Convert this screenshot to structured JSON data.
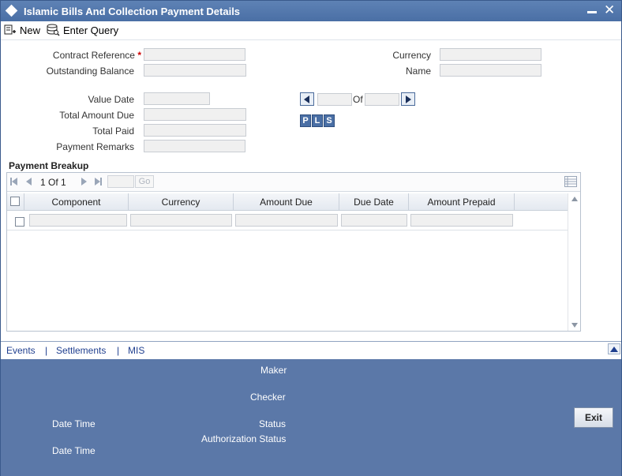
{
  "window": {
    "title": "Islamic Bills And Collection Payment Details",
    "close_glyph": "✕"
  },
  "toolbar": {
    "new_label": "New",
    "enter_query_label": "Enter Query"
  },
  "form": {
    "contract_reference_label": "Contract Reference",
    "required_mark": "*",
    "outstanding_balance_label": "Outstanding Balance",
    "currency_label": "Currency",
    "name_label": "Name",
    "value_date_label": "Value Date",
    "total_amount_due_label": "Total Amount Due",
    "total_paid_label": "Total Paid",
    "payment_remarks_label": "Payment Remarks",
    "of_label": "Of",
    "pls_buttons": [
      "P",
      "L",
      "S"
    ]
  },
  "payment_breakup": {
    "title": "Payment Breakup",
    "page_current": "1",
    "page_of_label": "Of",
    "page_total": "1",
    "go_label": "Go",
    "columns": [
      "Component",
      "Currency",
      "Amount Due",
      "Due Date",
      "Amount Prepaid"
    ]
  },
  "tabs": {
    "items": [
      "Events",
      "Settlements",
      "MIS"
    ],
    "separator": "|"
  },
  "footer": {
    "maker_label": "Maker",
    "checker_label": "Checker",
    "date_time_label": "Date Time",
    "status_label": "Status",
    "authorization_status_label": "Authorization Status",
    "exit_label": "Exit"
  },
  "colors": {
    "title_bar": "#4a6fa5",
    "footer": "#5b78a8",
    "link": "#1f3f8f",
    "required": "#cc0000"
  }
}
